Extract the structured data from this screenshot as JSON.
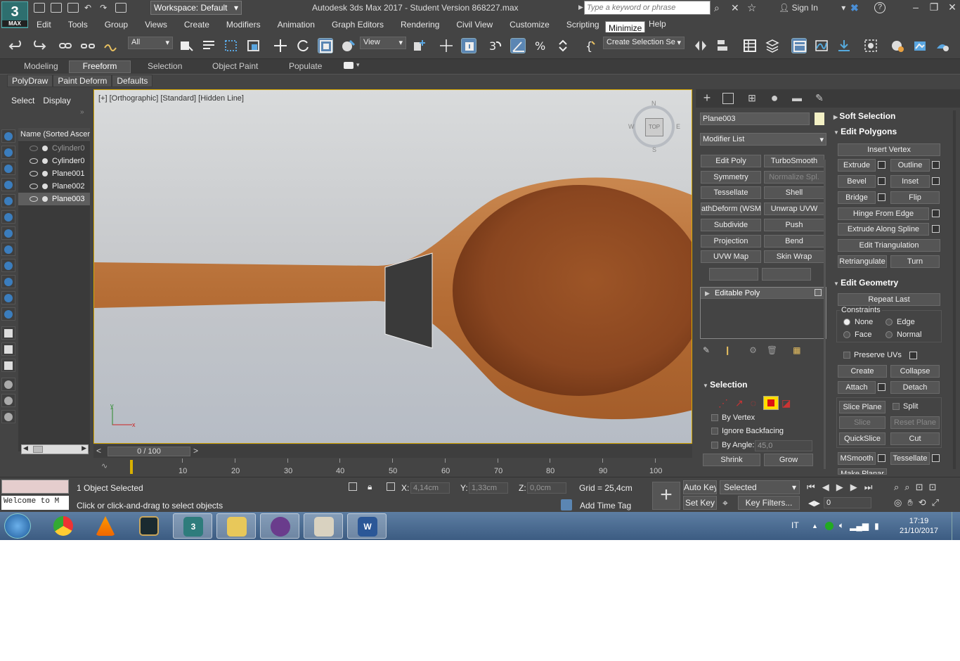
{
  "app": {
    "logo_number": "3",
    "logo_text": "MAX",
    "workspace": "Workspace: Default",
    "title": "Autodesk 3ds Max 2017 - Student Version    868227.max",
    "search_placeholder": "Type a keyword or phrase",
    "signin": "Sign In",
    "help_icon": "?"
  },
  "menu": [
    "Edit",
    "Tools",
    "Group",
    "Views",
    "Create",
    "Modifiers",
    "Animation",
    "Graph Editors",
    "Rendering",
    "Civil View",
    "Customize",
    "Scripting"
  ],
  "menu_help": "Help",
  "tooltip": "Minimize",
  "toolbar": {
    "filter": "All",
    "refcoord": "View",
    "selset": "Create Selection Se"
  },
  "ribbon": {
    "tabs": [
      "Modeling",
      "Freeform",
      "Selection",
      "Object Paint",
      "Populate"
    ],
    "active": "Freeform",
    "sub": [
      "PolyDraw",
      "Paint Deform",
      "Defaults"
    ]
  },
  "scene_explorer": {
    "tabs": [
      "Select",
      "Display"
    ],
    "header": "Name (Sorted Ascer",
    "items": [
      "Cylinder0",
      "Cylinder0",
      "Plane001",
      "Plane002",
      "Plane003"
    ]
  },
  "viewport": {
    "label": "[+] [Orthographic] [Standard] [Hidden Line]",
    "cube_top": "TOP",
    "cube_n": "N",
    "cube_s": "S",
    "cube_w": "W",
    "cube_e": "E",
    "axis_x": "x",
    "axis_y": "y"
  },
  "timeline": {
    "frame": "0 / 100",
    "ticks": [
      "10",
      "20",
      "30",
      "40",
      "50",
      "60",
      "70",
      "80",
      "90",
      "100"
    ]
  },
  "command_panel": {
    "object_name": "Plane003",
    "modifier_list": "Modifier List",
    "modifiers": [
      "Edit Poly",
      "TurboSmooth",
      "Symmetry",
      "Normalize Spl.",
      "Tessellate",
      "Shell",
      "athDeform (WSM",
      "Unwrap UVW",
      "Subdivide",
      "Push",
      "Projection",
      "Bend",
      "UVW Map",
      "Skin Wrap"
    ],
    "stack_item": "Editable Poly",
    "selection": {
      "header": "Selection",
      "by_vertex": "By Vertex",
      "ignore_backfacing": "Ignore Backfacing",
      "by_angle": "By Angle:",
      "angle_value": "45,0",
      "shrink": "Shrink",
      "grow": "Grow"
    },
    "soft_selection": "Soft Selection",
    "edit_polygons": {
      "header": "Edit Polygons",
      "insert_vertex": "Insert Vertex",
      "extrude": "Extrude",
      "outline": "Outline",
      "bevel": "Bevel",
      "inset": "Inset",
      "bridge": "Bridge",
      "flip": "Flip",
      "hinge": "Hinge From Edge",
      "extrude_spline": "Extrude Along Spline",
      "edit_tri": "Edit Triangulation",
      "retri": "Retriangulate",
      "turn": "Turn"
    },
    "edit_geometry": {
      "header": "Edit Geometry",
      "repeat_last": "Repeat Last",
      "constraints": "Constraints",
      "none": "None",
      "edge": "Edge",
      "face": "Face",
      "normal": "Normal",
      "preserve_uvs": "Preserve UVs",
      "create": "Create",
      "collapse": "Collapse",
      "attach": "Attach",
      "detach": "Detach",
      "slice_plane": "Slice Plane",
      "split": "Split",
      "slice": "Slice",
      "reset_plane": "Reset Plane",
      "quickslice": "QuickSlice",
      "cut": "Cut",
      "msmooth": "MSmooth",
      "tessellate": "Tessellate",
      "make_planar": "Make Planar"
    }
  },
  "status": {
    "welcome": "Welcome to M",
    "selected": "1 Object Selected",
    "prompt": "Click or click-and-drag to select objects",
    "x_label": "X:",
    "x_val": "4,14cm",
    "y_label": "Y:",
    "y_val": "1,33cm",
    "z_label": "Z:",
    "z_val": "0,0cm",
    "grid": "Grid = 25,4cm",
    "add_time_tag": "Add Time Tag",
    "auto_key": "Auto Key",
    "set_key": "Set Key",
    "key_mode": "Selected",
    "key_filters": "Key Filters...",
    "frame_val": "0"
  },
  "taskbar": {
    "lang": "IT",
    "time": "17:19",
    "date": "21/10/2017"
  },
  "colors": {
    "accent": "#5b86b3",
    "viewport_border": "#d8a800",
    "object_color": "#f3f0c4",
    "selection_active": "#ffdd00"
  }
}
